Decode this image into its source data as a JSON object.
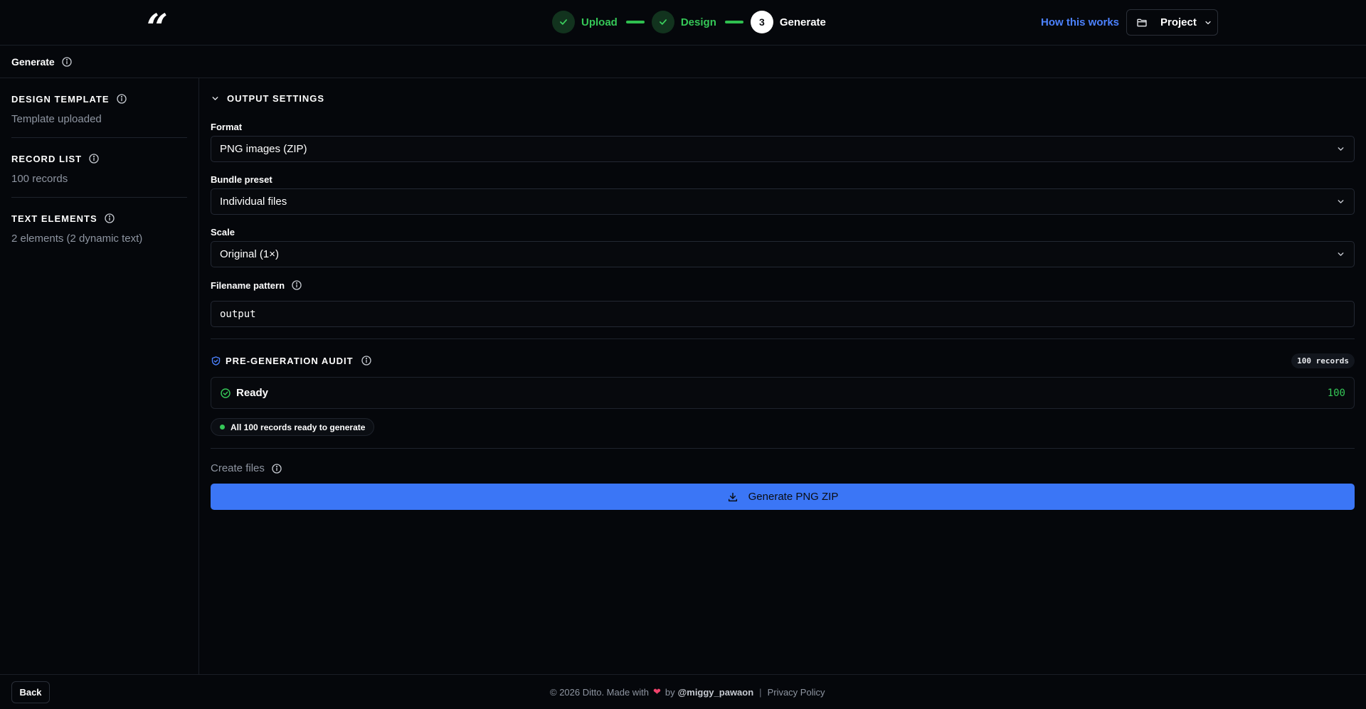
{
  "app": {
    "logo": "“"
  },
  "steps": [
    {
      "label": "Upload",
      "state": "done",
      "number": ""
    },
    {
      "label": "Design",
      "state": "done",
      "number": ""
    },
    {
      "label": "Generate",
      "state": "current",
      "number": "3"
    }
  ],
  "header": {
    "how_link": "How this works",
    "project_label": "Project"
  },
  "subheader": {
    "title": "Generate"
  },
  "sidebar": {
    "items": [
      {
        "title": "DESIGN TEMPLATE",
        "subtitle": "Template uploaded"
      },
      {
        "title": "RECORD LIST",
        "subtitle": "100 records"
      },
      {
        "title": "TEXT ELEMENTS",
        "subtitle": "2 elements (2 dynamic text)"
      }
    ]
  },
  "output_settings": {
    "title": "OUTPUT SETTINGS",
    "format": {
      "label": "Format",
      "value": "PNG images (ZIP)"
    },
    "bundle": {
      "label": "Bundle preset",
      "value": "Individual files"
    },
    "scale": {
      "label": "Scale",
      "value": "Original (1×)"
    },
    "filename": {
      "label": "Filename pattern",
      "value": "output"
    }
  },
  "audit": {
    "title": "PRE-GENERATION AUDIT",
    "badge": "100 records",
    "ready_label": "Ready",
    "ready_count": "100",
    "status_text": "All 100 records ready to generate"
  },
  "create": {
    "label": "Create files",
    "button": "Generate PNG ZIP"
  },
  "footer": {
    "back": "Back",
    "copyright": "© 2026 Ditto. Made with",
    "by": "by",
    "user": "@miggy_pawaon",
    "separator": "|",
    "privacy": "Privacy Policy"
  },
  "colors": {
    "accent": "#3b76f6",
    "success": "#35c757",
    "link": "#4c82ff",
    "background": "#05070b"
  }
}
